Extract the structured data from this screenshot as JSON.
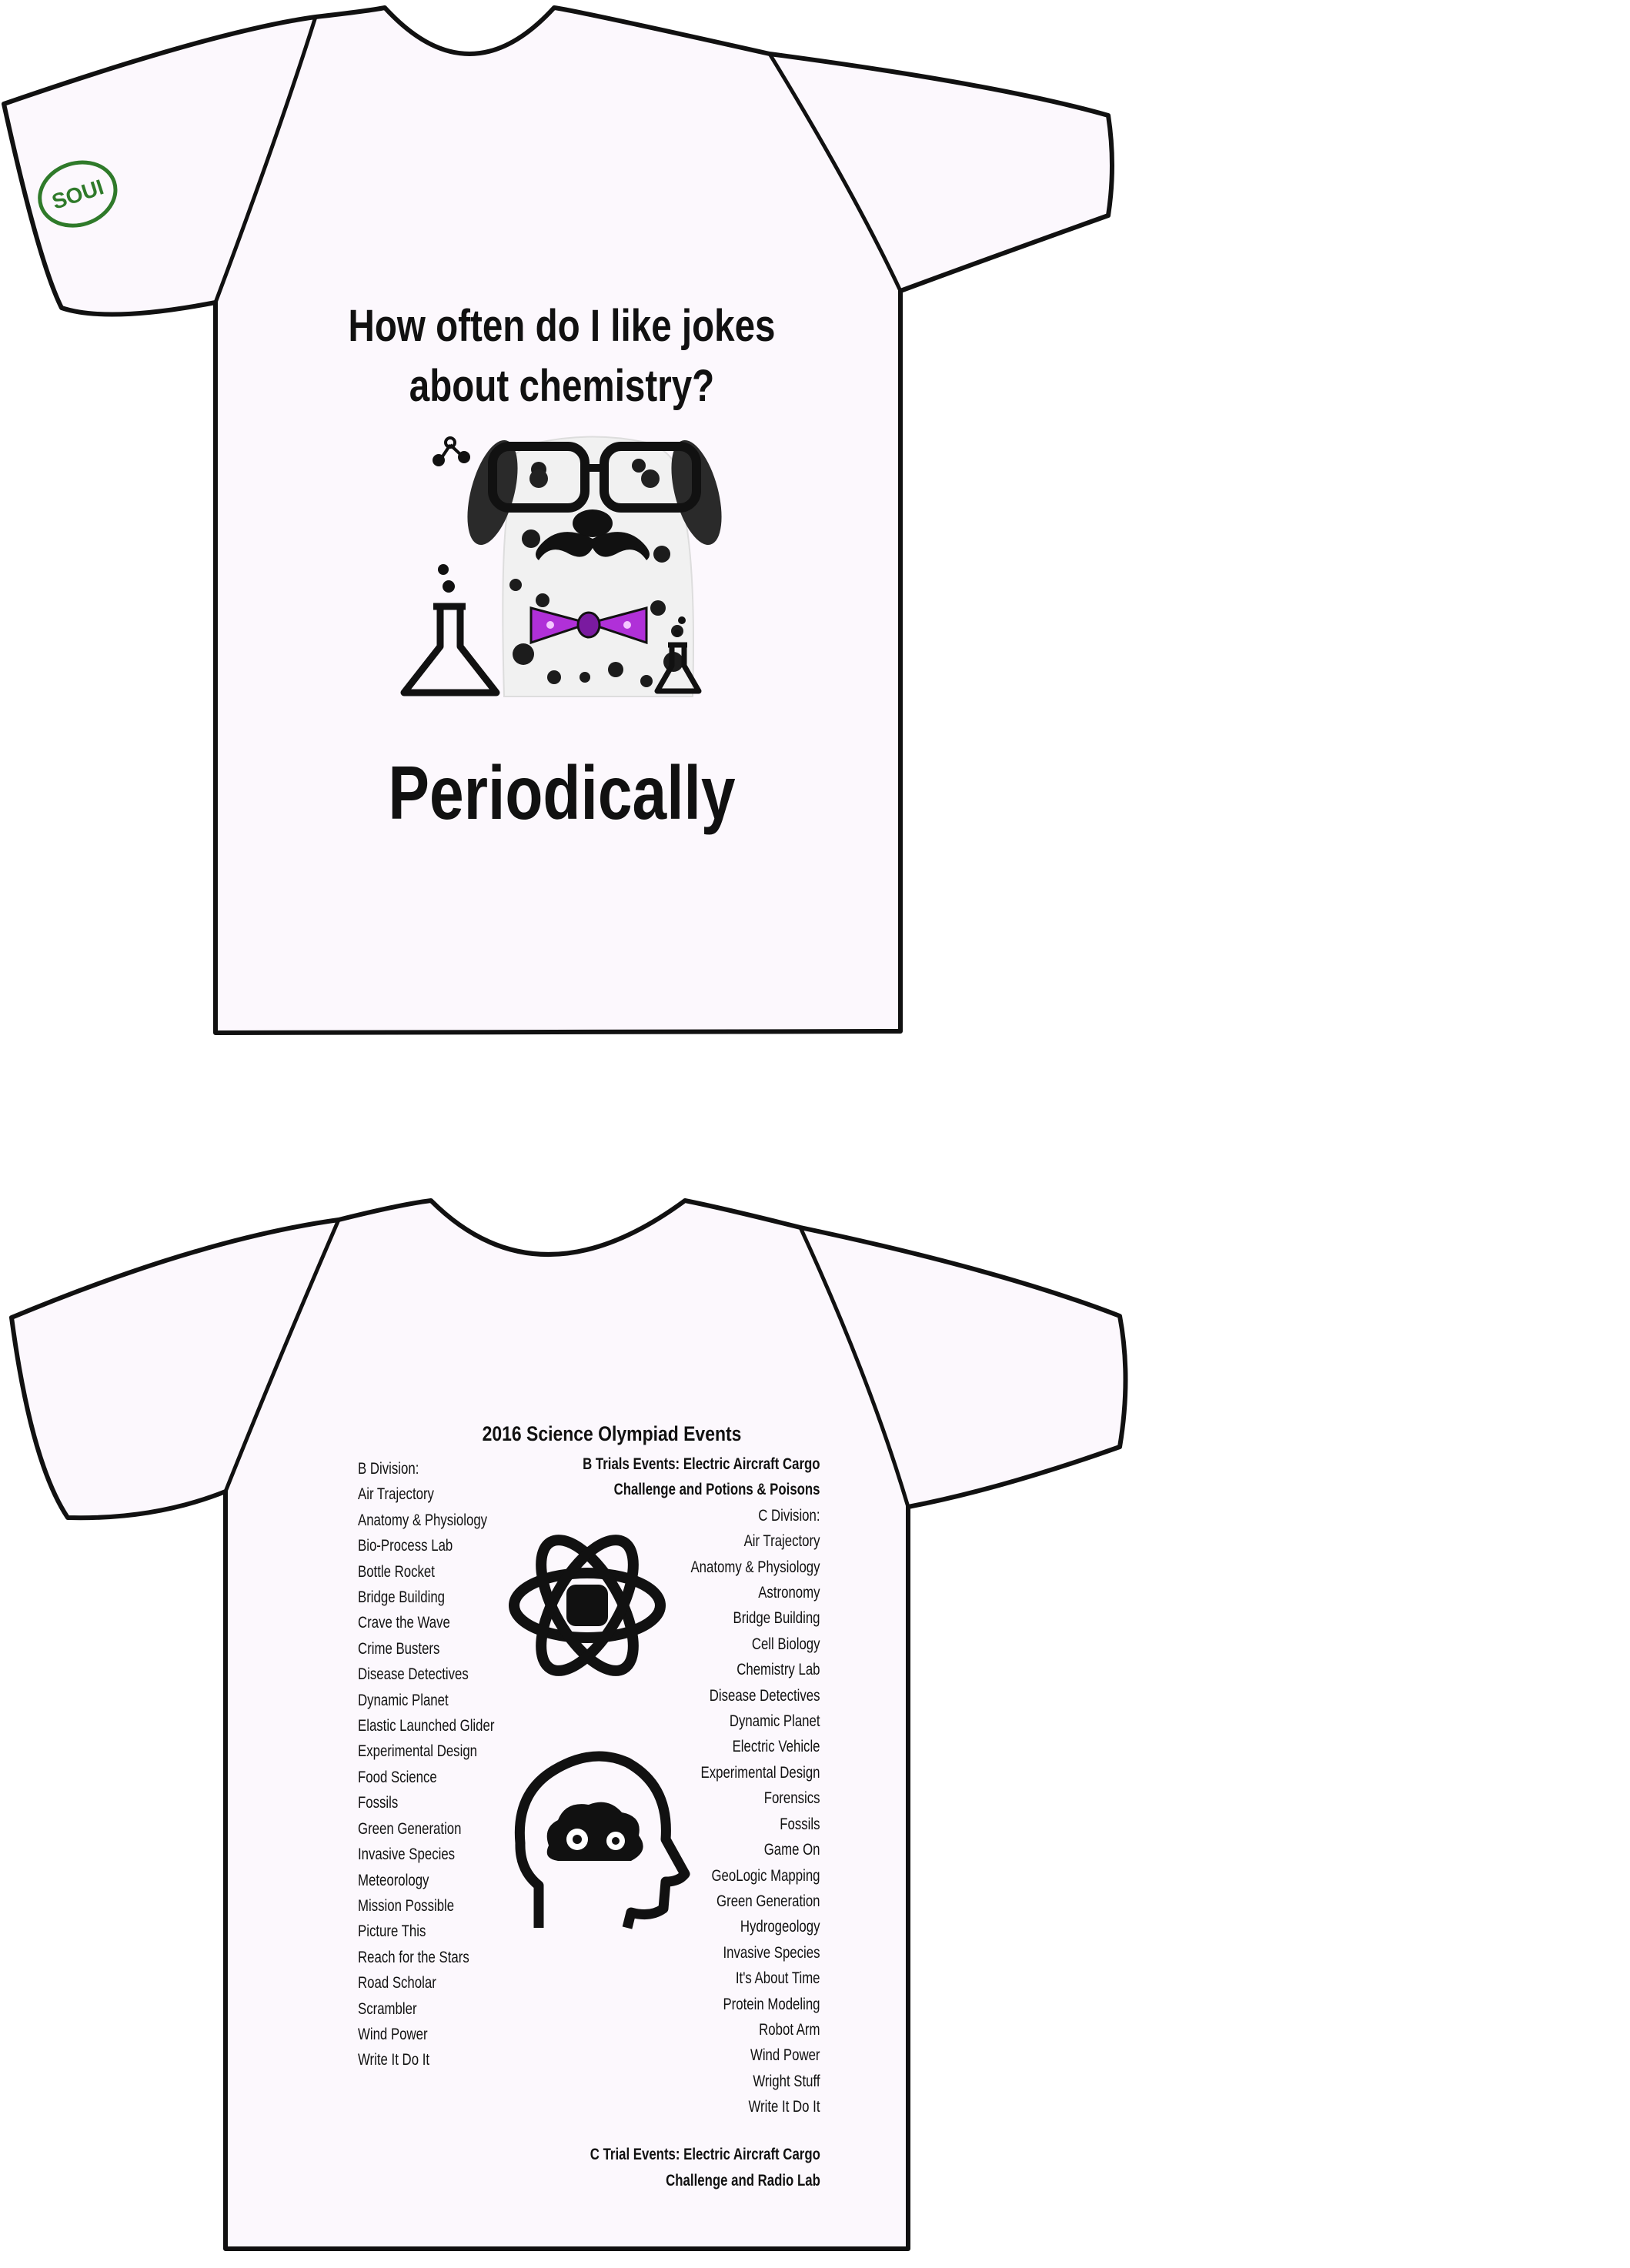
{
  "front": {
    "question_line1": "How often do I like jokes",
    "question_line2": "about chemistry?",
    "answer": "Periodically",
    "sleeve_logo_text": "SOUI"
  },
  "back": {
    "title": "2016 Science Olympiad Events",
    "b_division": [
      "B Division:",
      "Air Trajectory",
      "Anatomy & Physiology",
      "Bio-Process Lab",
      "Bottle Rocket",
      "Bridge Building",
      "Crave the Wave",
      "Crime Busters",
      "Disease Detectives",
      "Dynamic Planet",
      "Elastic Launched Glider",
      "Experimental Design",
      "Food Science",
      "Fossils",
      "Green Generation",
      "Invasive Species",
      "Meteorology",
      "Mission Possible",
      "Picture This",
      "Reach for the Stars",
      "Road Scholar",
      "Scrambler",
      "Wind Power",
      "Write It Do It"
    ],
    "b_trials_line1": "B Trials Events: Electric Aircraft Cargo",
    "b_trials_line2": "Challenge and Potions & Poisons",
    "c_division": [
      "C Division:",
      "Air Trajectory",
      "Anatomy & Physiology",
      "Astronomy",
      "Bridge Building",
      "Cell Biology",
      "Chemistry Lab",
      "Disease Detectives",
      "Dynamic Planet",
      "Electric Vehicle",
      "Experimental Design",
      "Forensics",
      "Fossils",
      "Game On",
      "GeoLogic Mapping",
      "Green Generation",
      "Hydrogeology",
      "Invasive Species",
      "It's About Time",
      "Protein Modeling",
      "Robot Arm",
      "Wind Power",
      "Wright Stuff",
      "Write It Do It"
    ],
    "c_trials_line1": "C Trial Events: Electric Aircraft Cargo",
    "c_trials_line2": "Challenge and Radio Lab"
  },
  "colors": {
    "shirt_fill": "#fcf8fd",
    "outline": "#111111",
    "bowtie": "#b030d8",
    "logo_green": "#2f7a2a"
  }
}
